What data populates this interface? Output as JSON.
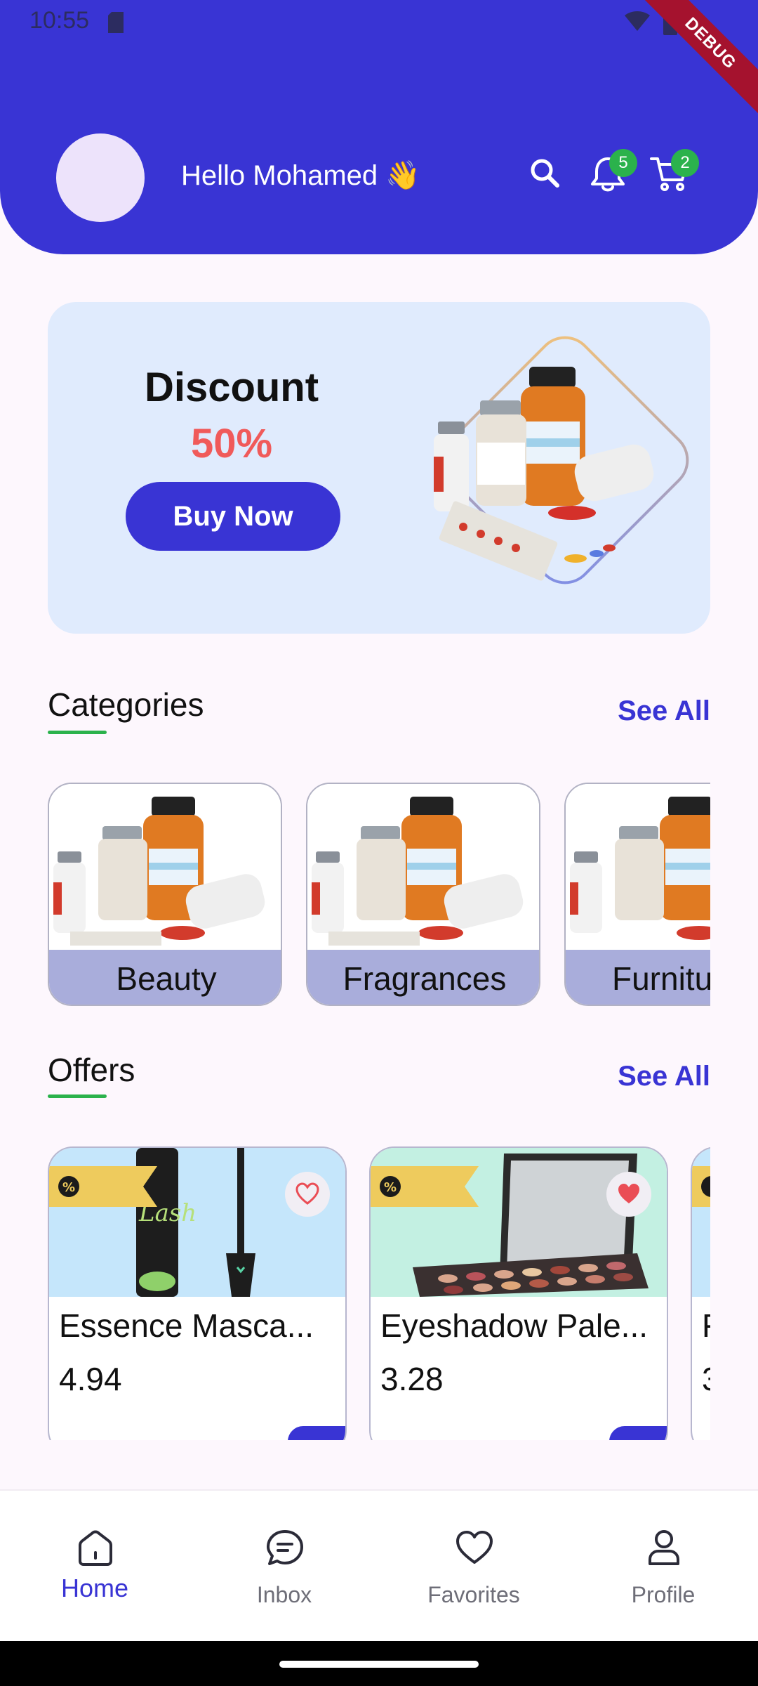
{
  "status_bar": {
    "time": "10:55",
    "debug_label": "DEBUG"
  },
  "header": {
    "greeting": "Hello Mohamed 👋",
    "notifications_count": "5",
    "cart_count": "2"
  },
  "banner": {
    "title": "Discount",
    "percent": "50%",
    "button_label": "Buy Now"
  },
  "categories": {
    "title": "Categories",
    "see_all": "See All",
    "items": [
      {
        "label": "Beauty"
      },
      {
        "label": "Fragrances"
      },
      {
        "label": "Furnitu"
      }
    ]
  },
  "offers": {
    "title": "Offers",
    "see_all": "See All",
    "items": [
      {
        "name": "Essence Masca...",
        "price": "4.94",
        "favorited": false
      },
      {
        "name": "Eyeshadow Pale...",
        "price": "3.28",
        "favorited": true
      },
      {
        "name": "F",
        "price": "3",
        "favorited": false
      }
    ]
  },
  "bottom_nav": {
    "items": [
      {
        "label": "Home",
        "icon": "home-icon",
        "active": true
      },
      {
        "label": "Inbox",
        "icon": "chat-icon",
        "active": false
      },
      {
        "label": "Favorites",
        "icon": "heart-icon",
        "active": false
      },
      {
        "label": "Profile",
        "icon": "person-icon",
        "active": false
      }
    ]
  },
  "colors": {
    "primary": "#3934d4",
    "accent_green": "#2bb24c",
    "discount_red": "#f05a5a",
    "banner_bg": "#e0ebfd",
    "category_label_bg": "#a9addb",
    "offer_tag": "#eecb5d"
  }
}
